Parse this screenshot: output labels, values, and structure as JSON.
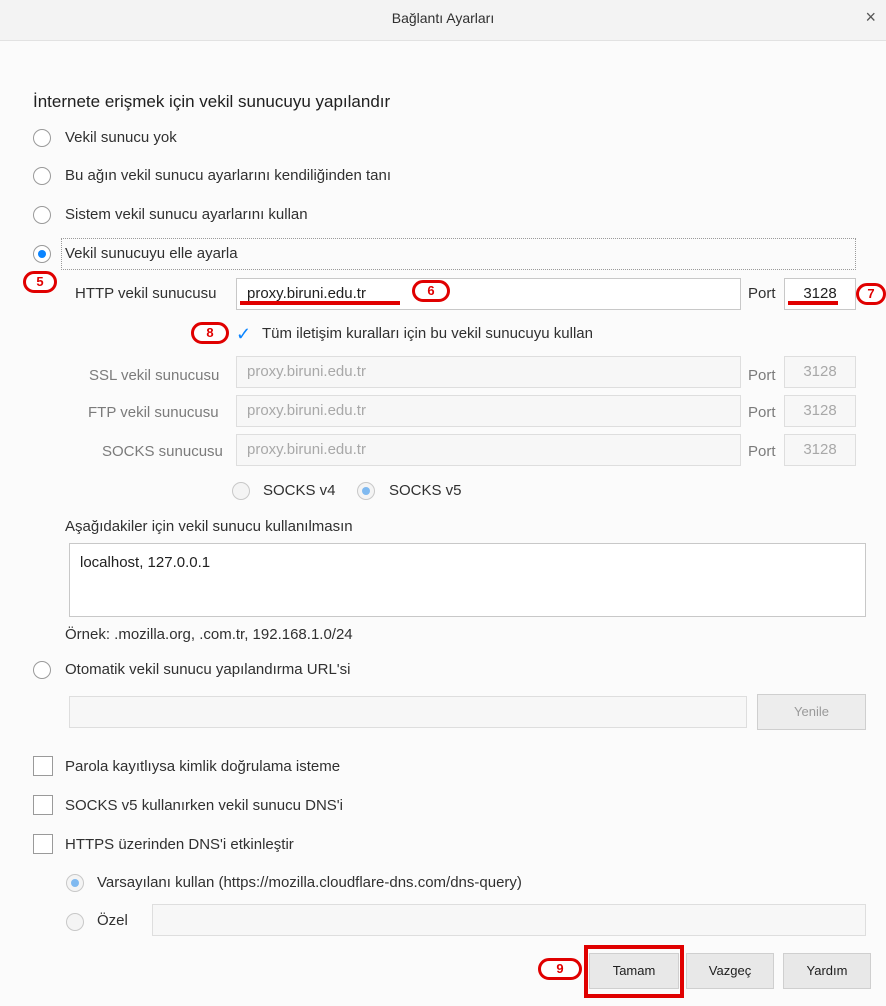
{
  "window": {
    "title": "Bağlantı Ayarları",
    "close_glyph": "×"
  },
  "heading": "İnternete erişmek için vekil sunucuyu yapılandır",
  "radios": {
    "none": "Vekil sunucu yok",
    "auto_detect": "Bu ağın vekil sunucu ayarlarını kendiliğinden tanı",
    "system": "Sistem vekil sunucu ayarlarını kullan",
    "manual": "Vekil sunucuyu elle ayarla",
    "selected": "manual"
  },
  "manual": {
    "http_label": "HTTP vekil sunucusu",
    "http_value": "proxy.biruni.edu.tr",
    "port_label": "Port",
    "http_port": "3128",
    "use_all_label": "Tüm iletişim kuralları için bu vekil sunucuyu kullan",
    "use_all_checked": true,
    "ssl_label": "SSL vekil sunucusu",
    "ssl_value": "proxy.biruni.edu.tr",
    "ssl_port": "3128",
    "ftp_label": "FTP vekil sunucusu",
    "ftp_value": "proxy.biruni.edu.tr",
    "ftp_port": "3128",
    "socks_label": "SOCKS sunucusu",
    "socks_value": "proxy.biruni.edu.tr",
    "socks_port": "3128",
    "socks_v4": "SOCKS v4",
    "socks_v5": "SOCKS v5",
    "socks_selected": "v5"
  },
  "no_proxy": {
    "label": "Aşağıdakiler için vekil sunucu kullanılmasın",
    "value": "localhost, 127.0.0.1",
    "example": "Örnek: .mozilla.org, .com.tr, 192.168.1.0/24"
  },
  "auto_config": {
    "label": "Otomatik vekil sunucu yapılandırma URL'si",
    "url_value": "",
    "reload_button": "Yenile"
  },
  "options": {
    "no_auth_prompt": "Parola kayıtlıysa kimlik doğrulama isteme",
    "socks_dns": "SOCKS v5 kullanırken vekil sunucu DNS'i",
    "dns_over_https": "HTTPS üzerinden DNS'i etkinleştir",
    "doh_default": "Varsayılanı kullan (https://mozilla.cloudflare-dns.com/dns-query)",
    "doh_custom": "Özel",
    "doh_custom_value": ""
  },
  "buttons": {
    "ok": "Tamam",
    "cancel": "Vazgeç",
    "help": "Yardım"
  },
  "annotations": {
    "b5": "5",
    "b6": "6",
    "b7": "7",
    "b8": "8",
    "b9": "9"
  },
  "colors": {
    "accent": "#0a84ff",
    "annotation_red": "#e00000"
  }
}
